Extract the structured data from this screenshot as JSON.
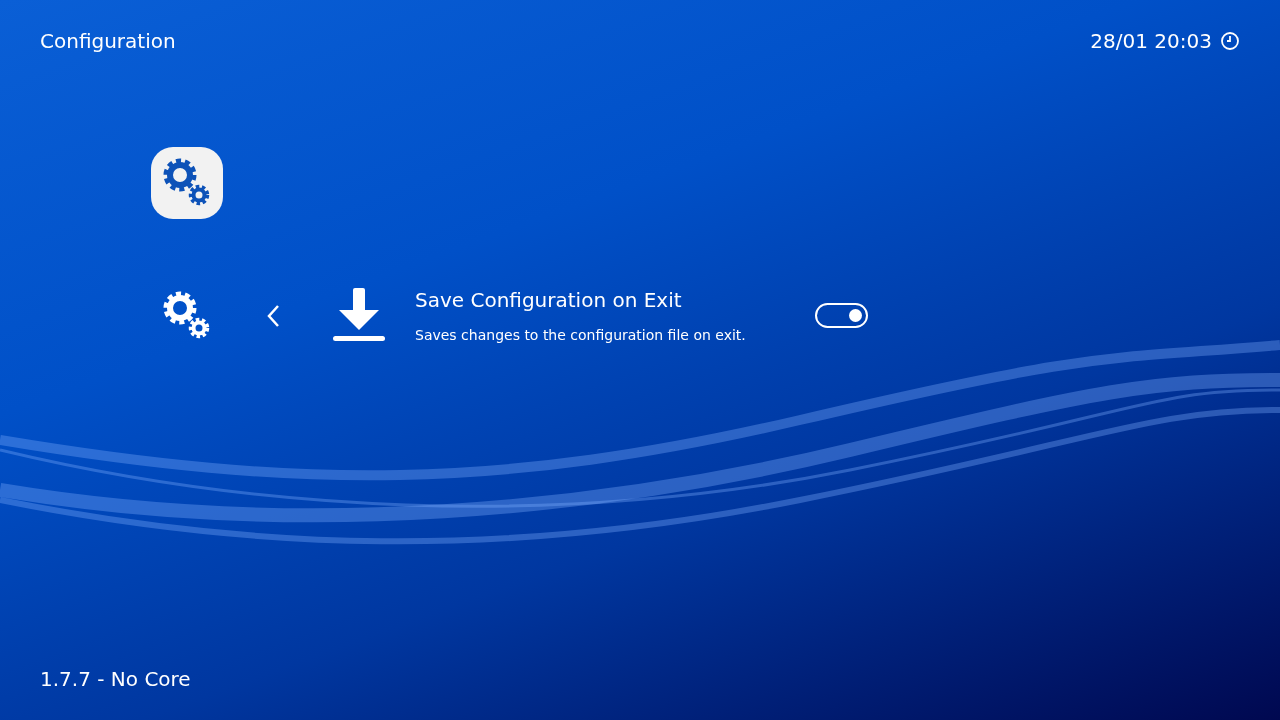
{
  "header": {
    "title": "Configuration",
    "datetime": "28/01 20:03"
  },
  "item": {
    "label": "Save Configuration on Exit",
    "description": "Saves changes to the configuration file on exit.",
    "on": true
  },
  "footer": {
    "version": "1.7.7 - No Core"
  }
}
